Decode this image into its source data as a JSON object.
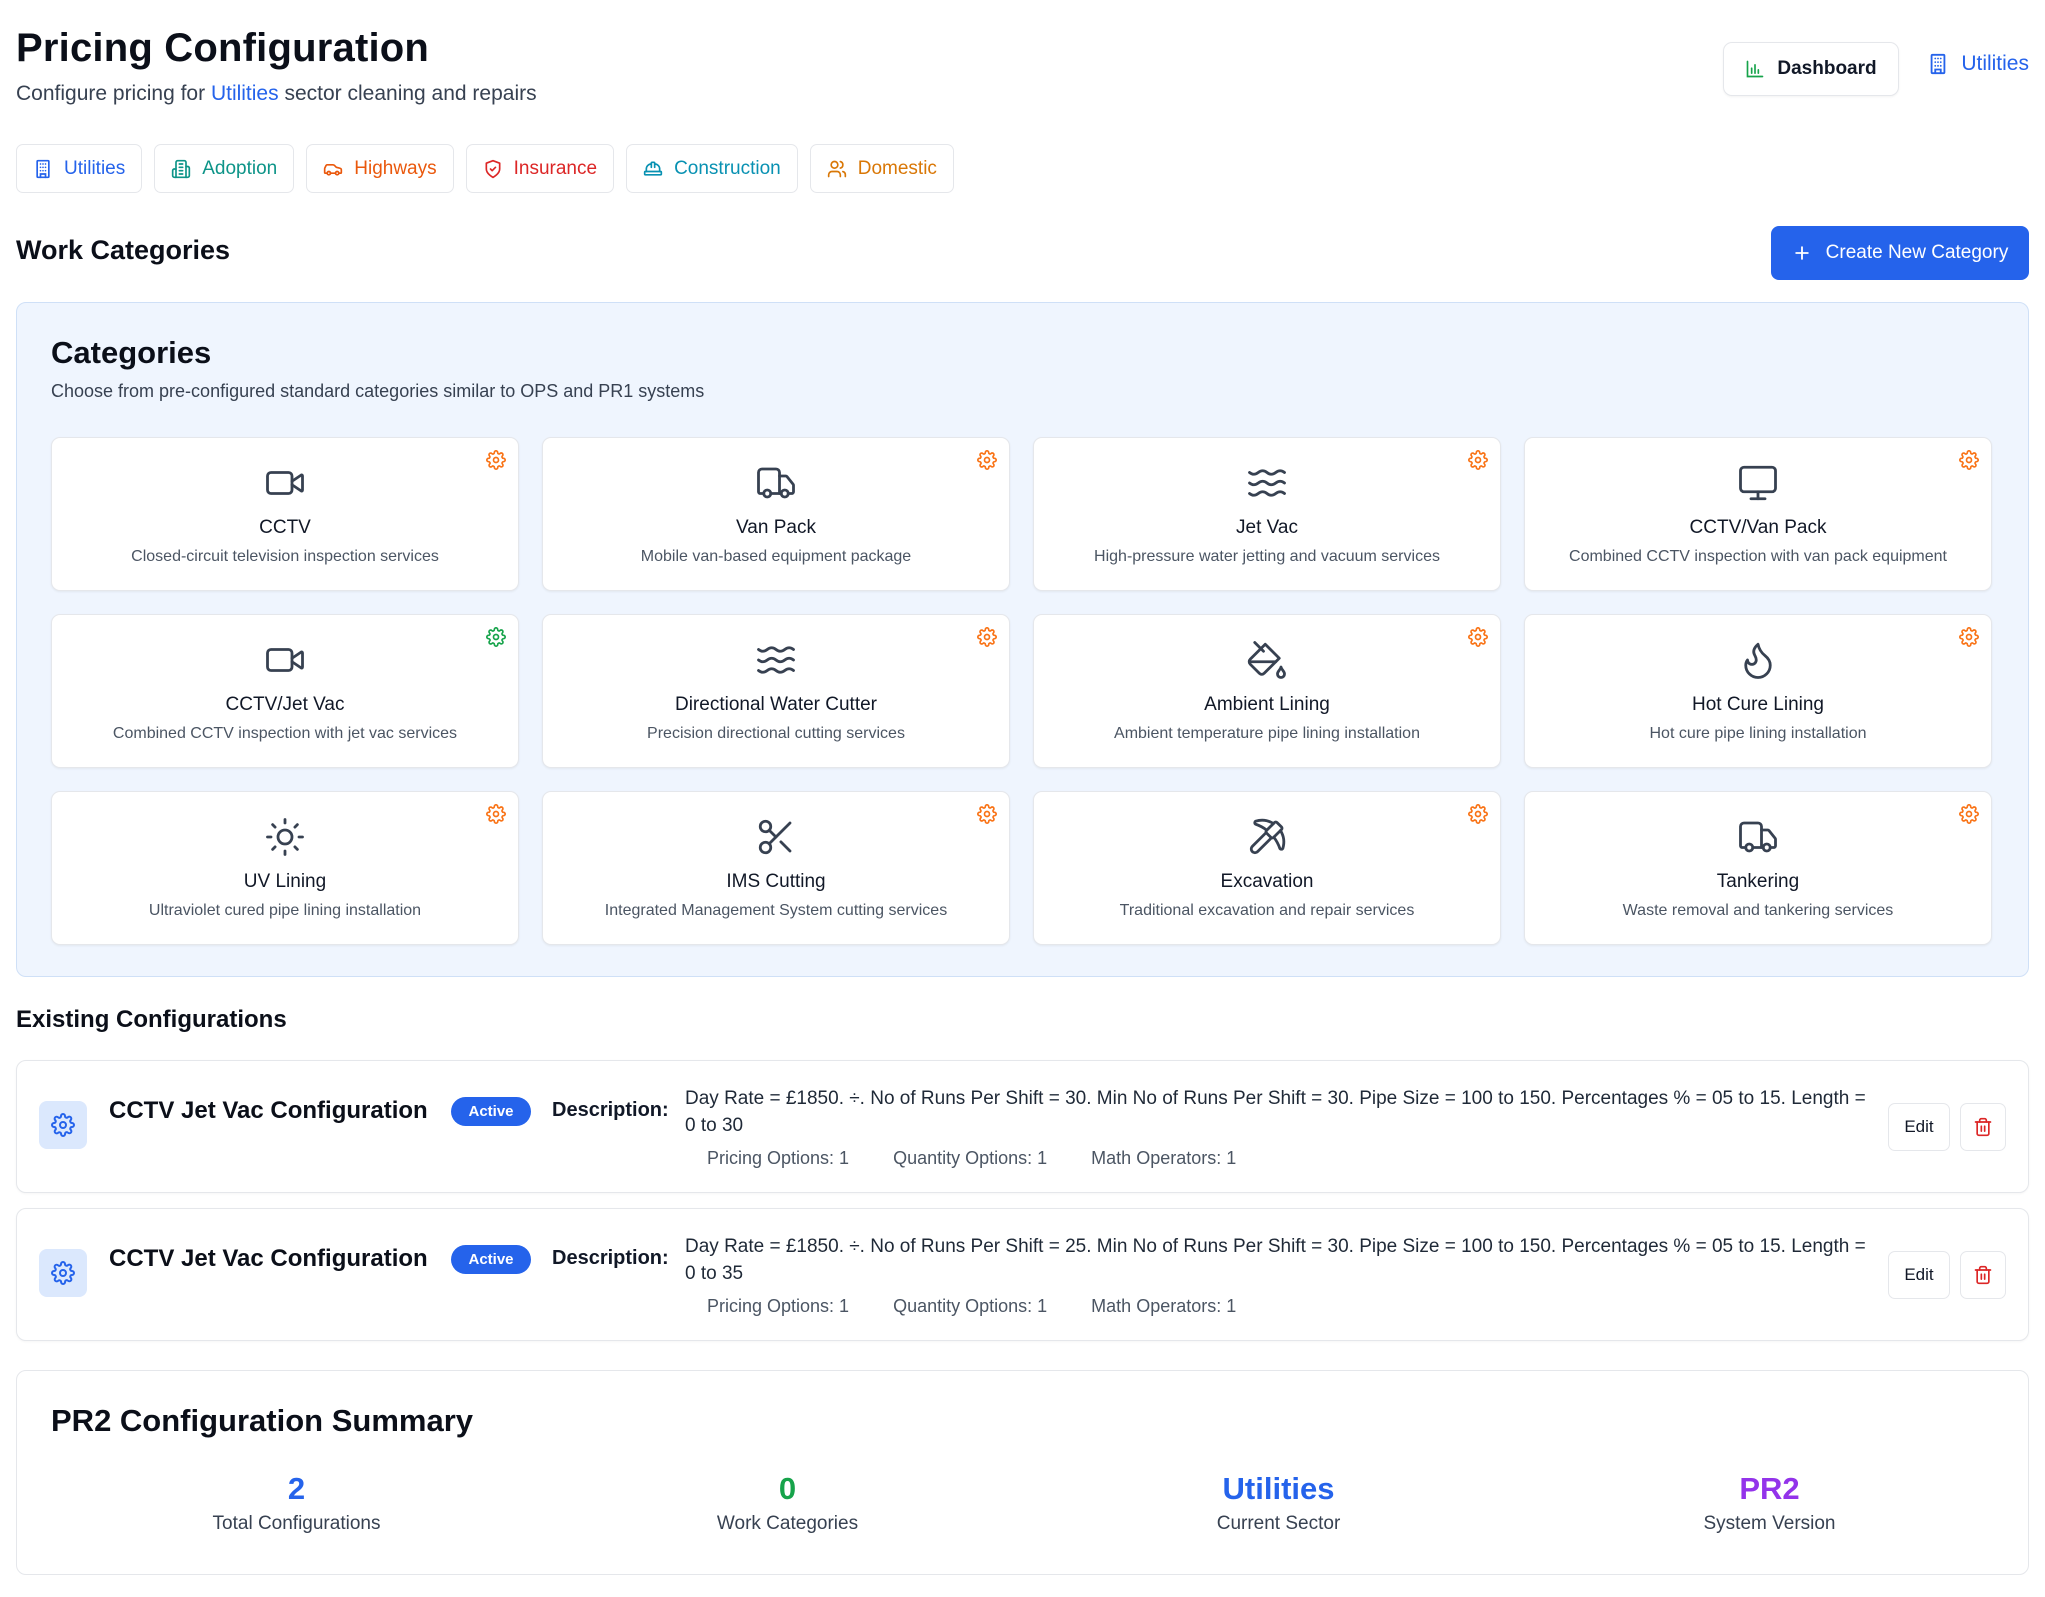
{
  "header": {
    "title": "Pricing Configuration",
    "subtitle_prefix": "Configure pricing for",
    "subtitle_sector": "Utilities",
    "subtitle_suffix": "sector cleaning and repairs",
    "dashboard_label": "Dashboard",
    "current_sector_label": "Utilities"
  },
  "sector_tabs": [
    {
      "label": "Utilities",
      "icon": "building-icon",
      "color": "#2563eb"
    },
    {
      "label": "Adoption",
      "icon": "buildings-icon",
      "color": "#0d9488"
    },
    {
      "label": "Highways",
      "icon": "car-icon",
      "color": "#ea580c"
    },
    {
      "label": "Insurance",
      "icon": "shield-icon",
      "color": "#dc2626"
    },
    {
      "label": "Construction",
      "icon": "hard-hat-icon",
      "color": "#0891b2"
    },
    {
      "label": "Domestic",
      "icon": "users-icon",
      "color": "#d97706"
    }
  ],
  "work_categories": {
    "title": "Work Categories",
    "create_label": "Create New Category"
  },
  "categories": {
    "title": "Categories",
    "subtitle": "Choose from pre-configured standard categories similar to OPS and PR1 systems",
    "items": [
      {
        "name": "CCTV",
        "desc": "Closed-circuit television inspection services",
        "icon": "video-camera-icon",
        "gear_color": "#f97316"
      },
      {
        "name": "Van Pack",
        "desc": "Mobile van-based equipment package",
        "icon": "truck-icon",
        "gear_color": "#f97316"
      },
      {
        "name": "Jet Vac",
        "desc": "High-pressure water jetting and vacuum services",
        "icon": "waves-icon",
        "gear_color": "#f97316"
      },
      {
        "name": "CCTV/Van Pack",
        "desc": "Combined CCTV inspection with van pack equipment",
        "icon": "monitor-icon",
        "gear_color": "#f97316"
      },
      {
        "name": "CCTV/Jet Vac",
        "desc": "Combined CCTV inspection with jet vac services",
        "icon": "video-camera-icon",
        "gear_color": "#16a34a"
      },
      {
        "name": "Directional Water Cutter",
        "desc": "Precision directional cutting services",
        "icon": "waves-icon",
        "gear_color": "#f97316"
      },
      {
        "name": "Ambient Lining",
        "desc": "Ambient temperature pipe lining installation",
        "icon": "paint-bucket-icon",
        "gear_color": "#f97316"
      },
      {
        "name": "Hot Cure Lining",
        "desc": "Hot cure pipe lining installation",
        "icon": "flame-icon",
        "gear_color": "#f97316"
      },
      {
        "name": "UV Lining",
        "desc": "Ultraviolet cured pipe lining installation",
        "icon": "sun-icon",
        "gear_color": "#f97316"
      },
      {
        "name": "IMS Cutting",
        "desc": "Integrated Management System cutting services",
        "icon": "scissors-icon",
        "gear_color": "#f97316"
      },
      {
        "name": "Excavation",
        "desc": "Traditional excavation and repair services",
        "icon": "pickaxe-icon",
        "gear_color": "#f97316"
      },
      {
        "name": "Tankering",
        "desc": "Waste removal and tankering services",
        "icon": "truck-icon",
        "gear_color": "#f97316"
      }
    ]
  },
  "existing": {
    "title": "Existing Configurations",
    "items": [
      {
        "name": "CCTV Jet Vac Configuration",
        "status": "Active",
        "desc_label": "Description:",
        "description": "Day Rate = £1850. ÷. No of Runs Per Shift = 30. Min No of Runs Per Shift = 30. Pipe Size = 100 to 150. Percentages % = 05 to 15. Length = 0 to 30",
        "pricing_options": "Pricing Options: 1",
        "quantity_options": "Quantity Options: 1",
        "math_operators": "Math Operators: 1",
        "edit_label": "Edit"
      },
      {
        "name": "CCTV Jet Vac Configuration",
        "status": "Active",
        "desc_label": "Description:",
        "description": "Day Rate = £1850. ÷. No of Runs Per Shift = 25. Min No of Runs Per Shift = 30. Pipe Size = 100 to 150. Percentages % = 05 to 15. Length = 0 to 35",
        "pricing_options": "Pricing Options: 1",
        "quantity_options": "Quantity Options: 1",
        "math_operators": "Math Operators: 1",
        "edit_label": "Edit"
      }
    ]
  },
  "summary": {
    "title": "PR2 Configuration Summary",
    "stats": [
      {
        "value": "2",
        "label": "Total Configurations",
        "color": "#2563eb"
      },
      {
        "value": "0",
        "label": "Work Categories",
        "color": "#16a34a"
      },
      {
        "value": "Utilities",
        "label": "Current Sector",
        "color": "#2563eb"
      },
      {
        "value": "PR2",
        "label": "System Version",
        "color": "#9333ea"
      }
    ]
  },
  "colors": {
    "primary": "#2563eb",
    "panel_bg": "#eff5fe",
    "delete": "#dc2626"
  }
}
